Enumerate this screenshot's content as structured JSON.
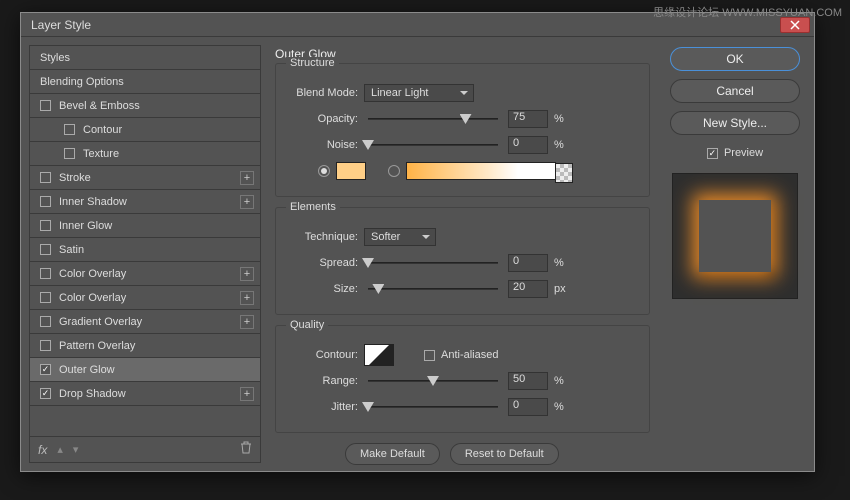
{
  "watermark": "思缘设计论坛 WWW.MISSYUAN.COM",
  "dialog": {
    "title": "Layer Style"
  },
  "styles_list": {
    "header": "Styles",
    "blending": "Blending Options",
    "items": [
      {
        "label": "Bevel & Emboss",
        "checked": false,
        "plus": false
      },
      {
        "label": "Contour",
        "checked": false,
        "plus": false,
        "sub": true
      },
      {
        "label": "Texture",
        "checked": false,
        "plus": false,
        "sub": true
      },
      {
        "label": "Stroke",
        "checked": false,
        "plus": true
      },
      {
        "label": "Inner Shadow",
        "checked": false,
        "plus": true
      },
      {
        "label": "Inner Glow",
        "checked": false,
        "plus": false
      },
      {
        "label": "Satin",
        "checked": false,
        "plus": false
      },
      {
        "label": "Color Overlay",
        "checked": false,
        "plus": true
      },
      {
        "label": "Color Overlay",
        "checked": false,
        "plus": true
      },
      {
        "label": "Gradient Overlay",
        "checked": false,
        "plus": true
      },
      {
        "label": "Pattern Overlay",
        "checked": false,
        "plus": false
      },
      {
        "label": "Outer Glow",
        "checked": true,
        "plus": false,
        "selected": true
      },
      {
        "label": "Drop Shadow",
        "checked": true,
        "plus": true
      }
    ],
    "fx": "fx"
  },
  "outer_glow": {
    "title": "Outer Glow",
    "structure": {
      "label": "Structure",
      "blend_mode_label": "Blend Mode:",
      "blend_mode": "Linear Light",
      "opacity_label": "Opacity:",
      "opacity": "75",
      "opacity_unit": "%",
      "noise_label": "Noise:",
      "noise": "0",
      "noise_unit": "%",
      "swatch_color": "#ffcf87"
    },
    "elements": {
      "label": "Elements",
      "technique_label": "Technique:",
      "technique": "Softer",
      "spread_label": "Spread:",
      "spread": "0",
      "spread_unit": "%",
      "size_label": "Size:",
      "size": "20",
      "size_unit": "px"
    },
    "quality": {
      "label": "Quality",
      "contour_label": "Contour:",
      "anti_aliased": "Anti-aliased",
      "range_label": "Range:",
      "range": "50",
      "range_unit": "%",
      "jitter_label": "Jitter:",
      "jitter": "0",
      "jitter_unit": "%"
    },
    "make_default": "Make Default",
    "reset_default": "Reset to Default"
  },
  "buttons": {
    "ok": "OK",
    "cancel": "Cancel",
    "new_style": "New Style...",
    "preview": "Preview"
  }
}
